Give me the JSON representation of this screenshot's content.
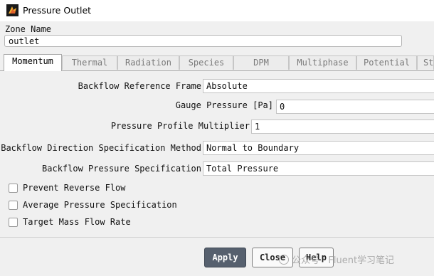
{
  "window": {
    "title": "Pressure Outlet",
    "icon": "fluent-app-icon"
  },
  "zone": {
    "label": "Zone Name",
    "value": "outlet"
  },
  "tabs": [
    {
      "label": "Momentum",
      "active": true
    },
    {
      "label": "Thermal"
    },
    {
      "label": "Radiation"
    },
    {
      "label": "Species"
    },
    {
      "label": "DPM"
    },
    {
      "label": "Multiphase"
    },
    {
      "label": "Potential"
    },
    {
      "label": "St"
    }
  ],
  "momentum": {
    "backflow_reference_frame": {
      "label": "Backflow Reference Frame",
      "value": "Absolute"
    },
    "gauge_pressure": {
      "label": "Gauge Pressure [Pa]",
      "value": "0"
    },
    "pressure_profile_multiplier": {
      "label": "Pressure Profile Multiplier",
      "value": "1"
    },
    "backflow_direction": {
      "label": "Backflow Direction Specification Method",
      "value": "Normal to Boundary"
    },
    "backflow_pressure": {
      "label": "Backflow Pressure Specification",
      "value": "Total Pressure"
    },
    "checkboxes": [
      {
        "label": "Prevent Reverse Flow",
        "checked": false
      },
      {
        "label": "Average Pressure Specification",
        "checked": false
      },
      {
        "label": "Target Mass Flow Rate",
        "checked": false
      }
    ]
  },
  "buttons": {
    "apply": "Apply",
    "close": "Close",
    "help": "Help"
  },
  "watermark": {
    "text": "公众号 · Fluent学习笔记"
  },
  "colors": {
    "apply_bg": "#56606e",
    "panel_bg": "#f0f0f0"
  }
}
